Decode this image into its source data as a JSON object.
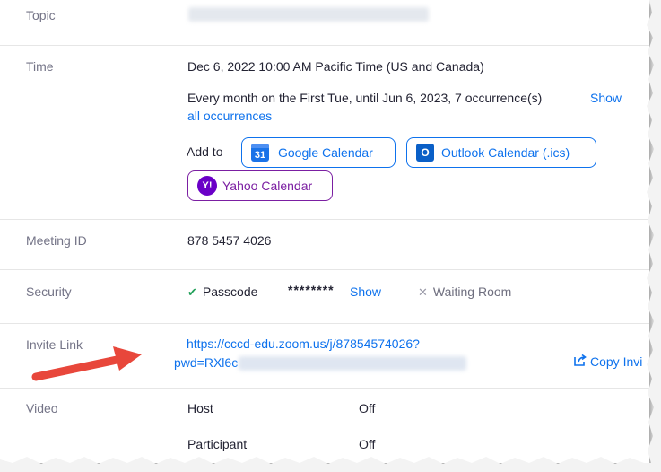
{
  "topic": {
    "label": "Topic"
  },
  "time": {
    "label": "Time",
    "datetime": "Dec 6, 2022 10:00 AM Pacific Time (US and Canada)",
    "recurrence": "Every month on the First Tue, until Jun 6, 2023, 7 occurrence(s)",
    "show_all_1": "Show",
    "show_all_2": "all occurrences",
    "add_to": "Add to",
    "google": "Google Calendar",
    "google_icon_text": "31",
    "outlook": "Outlook Calendar (.ics)",
    "outlook_icon_text": "O",
    "yahoo": "Yahoo Calendar",
    "yahoo_icon_text": "Y!"
  },
  "meeting_id": {
    "label": "Meeting ID",
    "value": "878 5457 4026"
  },
  "security": {
    "label": "Security",
    "passcode": "Passcode",
    "masked": "********",
    "show": "Show",
    "waiting_room": "Waiting Room"
  },
  "invite": {
    "label": "Invite Link",
    "url_line1": "https://cccd-edu.zoom.us/j/87854574026?",
    "url_line2": "pwd=RXl6c",
    "copy": "Copy Invi"
  },
  "video": {
    "label": "Video",
    "host": "Host",
    "host_value": "Off",
    "participant": "Participant",
    "participant_value": "Off"
  },
  "colors": {
    "accent": "#0e72ed",
    "yahoo": "#7b1fa2",
    "arrow": "#e8473b"
  }
}
